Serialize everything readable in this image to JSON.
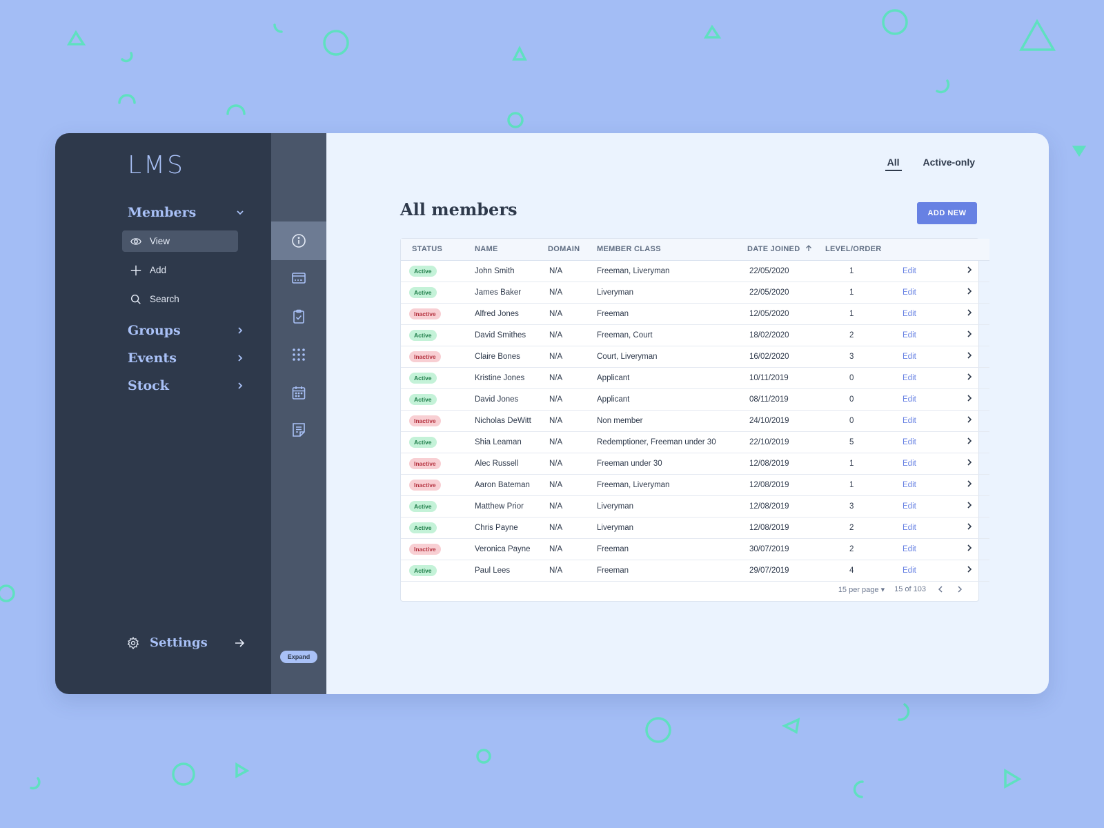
{
  "app": {
    "logo": "LMS"
  },
  "sidebar": {
    "sections": [
      {
        "label": "Members",
        "expanded": true
      },
      {
        "label": "Groups",
        "expanded": false
      },
      {
        "label": "Events",
        "expanded": false
      },
      {
        "label": "Stock",
        "expanded": false
      }
    ],
    "members_items": [
      {
        "label": "View",
        "icon": "eye-icon",
        "active": true
      },
      {
        "label": "Add",
        "icon": "plus-icon",
        "active": false
      },
      {
        "label": "Search",
        "icon": "search-icon",
        "active": false
      }
    ],
    "settings_label": "Settings"
  },
  "rail": {
    "items": [
      "info-icon",
      "id-card-icon",
      "clipboard-check-icon",
      "grid-dots-icon",
      "calendar-icon",
      "document-icon"
    ],
    "active_index": 0,
    "expand_label": "Expand"
  },
  "main": {
    "filters": [
      {
        "label": "All",
        "active": true
      },
      {
        "label": "Active-only",
        "active": false
      }
    ],
    "title": "All members",
    "add_button": "ADD NEW",
    "table": {
      "headers": {
        "status": "STATUS",
        "name": "NAME",
        "domain": "DOMAIN",
        "member_class": "MEMBER CLASS",
        "date_joined": "DATE JOINED",
        "level": "LEVEL/ORDER"
      },
      "sort_column": "date_joined",
      "edit_label": "Edit",
      "rows": [
        {
          "status": "Active",
          "name": "John Smith",
          "domain": "N/A",
          "member_class": "Freeman, Liveryman",
          "date_joined": "22/05/2020",
          "level": "1"
        },
        {
          "status": "Active",
          "name": "James Baker",
          "domain": "N/A",
          "member_class": "Liveryman",
          "date_joined": "22/05/2020",
          "level": "1"
        },
        {
          "status": "Inactive",
          "name": "Alfred Jones",
          "domain": "N/A",
          "member_class": "Freeman",
          "date_joined": "12/05/2020",
          "level": "1"
        },
        {
          "status": "Active",
          "name": "David Smithes",
          "domain": "N/A",
          "member_class": "Freeman, Court",
          "date_joined": "18/02/2020",
          "level": "2"
        },
        {
          "status": "Inactive",
          "name": "Claire Bones",
          "domain": "N/A",
          "member_class": "Court, Liveryman",
          "date_joined": "16/02/2020",
          "level": "3"
        },
        {
          "status": "Active",
          "name": "Kristine Jones",
          "domain": "N/A",
          "member_class": "Applicant",
          "date_joined": "10/11/2019",
          "level": "0"
        },
        {
          "status": "Active",
          "name": "David Jones",
          "domain": "N/A",
          "member_class": "Applicant",
          "date_joined": "08/11/2019",
          "level": "0"
        },
        {
          "status": "Inactive",
          "name": "Nicholas DeWitt",
          "domain": "N/A",
          "member_class": "Non member",
          "date_joined": "24/10/2019",
          "level": "0"
        },
        {
          "status": "Active",
          "name": "Shia Leaman",
          "domain": "N/A",
          "member_class": "Redemptioner, Freeman under 30",
          "date_joined": "22/10/2019",
          "level": "5"
        },
        {
          "status": "Inactive",
          "name": "Alec Russell",
          "domain": "N/A",
          "member_class": "Freeman under 30",
          "date_joined": "12/08/2019",
          "level": "1"
        },
        {
          "status": "Inactive",
          "name": "Aaron Bateman",
          "domain": "N/A",
          "member_class": "Freeman, Liveryman",
          "date_joined": "12/08/2019",
          "level": "1"
        },
        {
          "status": "Active",
          "name": "Matthew Prior",
          "domain": "N/A",
          "member_class": "Liveryman",
          "date_joined": "12/08/2019",
          "level": "3"
        },
        {
          "status": "Active",
          "name": "Chris Payne",
          "domain": "N/A",
          "member_class": "Liveryman",
          "date_joined": "12/08/2019",
          "level": "2"
        },
        {
          "status": "Inactive",
          "name": "Veronica Payne",
          "domain": "N/A",
          "member_class": "Freeman",
          "date_joined": "30/07/2019",
          "level": "2"
        },
        {
          "status": "Active",
          "name": "Paul Lees",
          "domain": "N/A",
          "member_class": "Freeman",
          "date_joined": "29/07/2019",
          "level": "4"
        }
      ]
    },
    "pagination": {
      "per_page": "15 per page",
      "range": "15 of 103"
    }
  },
  "colors": {
    "background": "#a3bdf5",
    "sidebar": "#2e394b",
    "rail": "#4a566a",
    "accent": "#6781e3",
    "active_badge": "#c4f2d8",
    "inactive_badge": "#f8cfd3",
    "decor": "#5fe0c0"
  }
}
